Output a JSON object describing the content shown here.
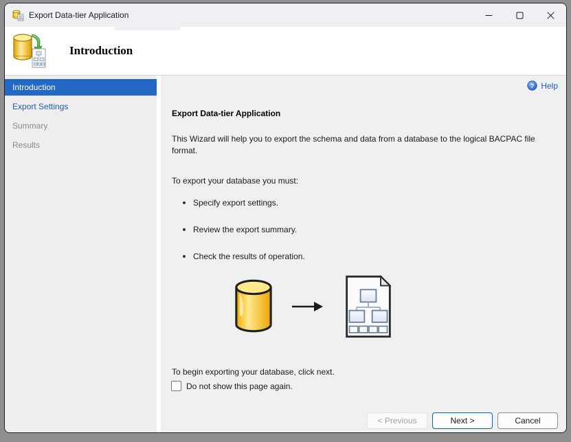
{
  "window": {
    "title": "Export Data-tier Application"
  },
  "header": {
    "title": "Introduction"
  },
  "sidebar": {
    "items": [
      {
        "label": "Introduction",
        "state": "active"
      },
      {
        "label": "Export Settings",
        "state": "link"
      },
      {
        "label": "Summary",
        "state": "disabled"
      },
      {
        "label": "Results",
        "state": "disabled"
      }
    ]
  },
  "content": {
    "help_label": "Help",
    "heading": "Export Data-tier Application",
    "paragraph": "This Wizard will help you to export the schema and data from a database to the logical BACPAC file format.",
    "list_intro": "To export your database you must:",
    "bullets": [
      "Specify export settings.",
      "Review the export summary.",
      "Check the results of operation."
    ],
    "begin_text": "To begin exporting your database, click next.",
    "checkbox_label": "Do not show this page again.",
    "checkbox_checked": false
  },
  "footer": {
    "previous_label": "< Previous",
    "next_label": "Next >",
    "cancel_label": "Cancel"
  },
  "icons": {
    "titlebar": "database-export-icon",
    "header": "database-export-icon",
    "help": "help-question-icon",
    "graphic_left": "database-icon",
    "graphic_middle": "arrow-right-icon",
    "graphic_right": "bacpac-document-icon"
  },
  "colors": {
    "accent_blue": "#2368c4",
    "link_blue": "#1b5cb8",
    "sidebar_bg": "#efeeec",
    "content_bg": "#f0f0f0",
    "titlebar_bg": "#eff0f4",
    "desktop_bg": "#8f8f8f",
    "db_yellow": "#f7c52d"
  }
}
